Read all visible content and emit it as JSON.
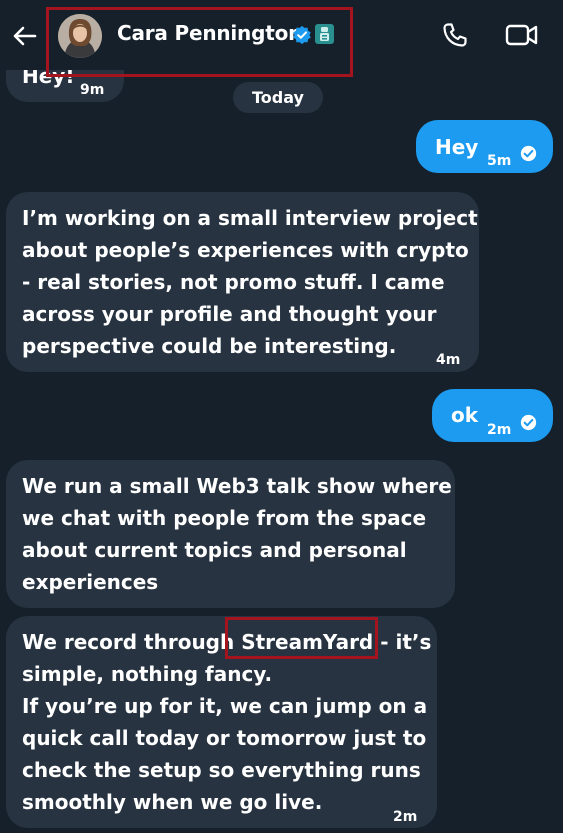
{
  "header": {
    "contact_name": "Cara Pennington",
    "back_icon": "back-arrow-icon",
    "verified_icon": "verified-badge-icon",
    "affiliation_icon": "affiliate-badge-icon",
    "call_icon": "phone-icon",
    "video_icon": "video-camera-icon"
  },
  "colors": {
    "background": "#15202b",
    "incoming_bubble": "#273340",
    "outgoing_bubble": "#1d9bf0",
    "highlight_box": "#a3141e"
  },
  "messages": [
    {
      "id": "m0",
      "direction": "incoming",
      "lines": [
        "Hey!"
      ],
      "time": "9m"
    },
    {
      "id": "m1",
      "direction": "outgoing",
      "lines": [
        "Hey"
      ],
      "time": "5m",
      "seen": true
    },
    {
      "id": "m2",
      "direction": "incoming",
      "lines": [
        "I’m working on a small interview project",
        "about people’s experiences with crypto",
        "- real stories, not promo stuff. I came",
        "across your profile and thought your",
        "perspective could be interesting."
      ],
      "time": "4m"
    },
    {
      "id": "m3",
      "direction": "outgoing",
      "lines": [
        "ok"
      ],
      "time": "2m",
      "seen": true
    },
    {
      "id": "m4",
      "direction": "incoming",
      "lines": [
        "We run a small Web3 talk show where",
        "we chat with people from the space",
        "about current topics and personal",
        "experiences"
      ],
      "time": ""
    },
    {
      "id": "m5",
      "direction": "incoming",
      "lines": [
        "We record through StreamYard - it’s",
        "simple, nothing fancy.",
        "If you’re up for it, we can jump on a",
        "quick call today or tomorrow just to",
        "check the setup so everything runs",
        "smoothly when we go live."
      ],
      "time": "2m"
    }
  ],
  "day_separator": "Today"
}
